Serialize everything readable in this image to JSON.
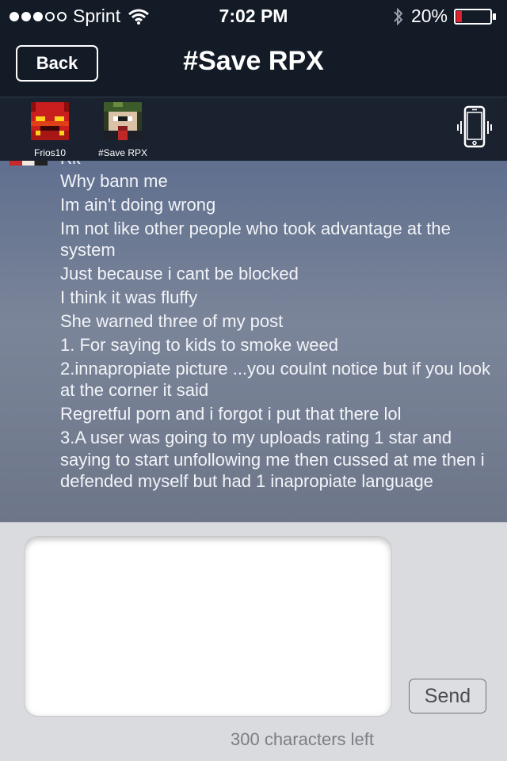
{
  "status_bar": {
    "carrier": "Sprint",
    "signal_bars_filled": 3,
    "signal_bars_total": 5,
    "time": "7:02 PM",
    "battery_percent": "20%",
    "battery_level": 0.2,
    "icons": [
      "wifi-icon",
      "bluetooth-icon",
      "battery-icon"
    ],
    "battery_color": "#e0202a"
  },
  "nav": {
    "back_label": "Back",
    "title": "#Save RPX"
  },
  "members": [
    {
      "name": "Frios10",
      "avatar": "red-pixel-avatar"
    },
    {
      "name": "#Save RPX",
      "avatar": "pixel-avatar"
    }
  ],
  "vibrate_icon": "phone-vibrate-icon",
  "chat": {
    "sender": "Rk",
    "lines": [
      "Why bann me",
      "Im ain't doing wrong",
      "Im not like other people who took advantage at the system",
      "Just because i cant be blocked",
      "I think it was fluffy",
      "She warned three of my post",
      "1. For saying to kids to smoke weed",
      "2.innapropiate picture ...you coulnt notice but if you look at the corner it said",
      "Regretful porn and i forgot i put that there lol",
      "3.A user was going to my uploads rating 1 star and saying to start unfollowing me then cussed at me then i defended myself but had 1 inapropiate language"
    ]
  },
  "composer": {
    "input_value": "",
    "send_label": "Send",
    "char_count": "300 characters left"
  }
}
